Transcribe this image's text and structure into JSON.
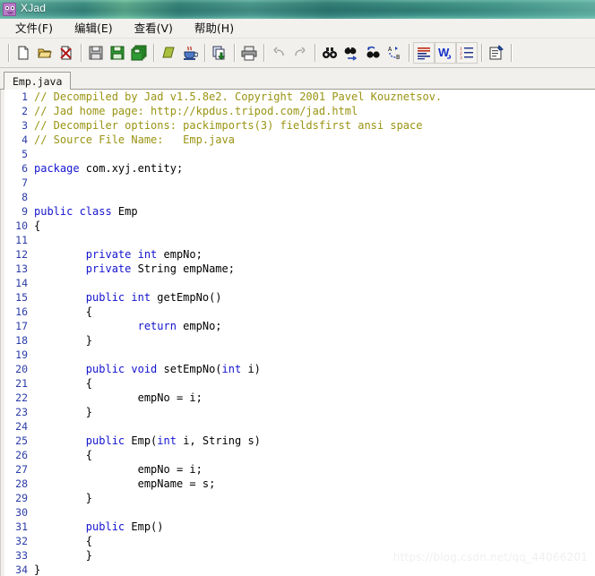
{
  "window": {
    "title": "XJad",
    "icon": "xjad-app-icon"
  },
  "menubar": {
    "items": [
      {
        "name": "file",
        "label": "文件(F)"
      },
      {
        "name": "edit",
        "label": "编辑(E)"
      },
      {
        "name": "view",
        "label": "查看(V)"
      },
      {
        "name": "help",
        "label": "帮助(H)"
      }
    ]
  },
  "toolbar": {
    "buttons": [
      {
        "name": "new-file-icon",
        "icon": "page",
        "state": "normal"
      },
      {
        "name": "open-folder-icon",
        "icon": "folder-open",
        "state": "normal"
      },
      {
        "name": "close-file-icon",
        "icon": "page-close-x",
        "state": "normal"
      },
      {
        "name": "save-icon",
        "icon": "floppy-gray",
        "state": "normal"
      },
      {
        "name": "save-as-icon",
        "icon": "floppy-green",
        "state": "normal"
      },
      {
        "name": "save-all-icon",
        "icon": "floppy-stack",
        "state": "normal"
      },
      {
        "name": "decompile-icon",
        "icon": "green-diamond",
        "state": "normal"
      },
      {
        "name": "java-coffee-icon",
        "icon": "coffee-cup",
        "state": "normal"
      },
      {
        "name": "export-file-icon",
        "icon": "page-arrow",
        "state": "normal"
      },
      {
        "name": "print-icon",
        "icon": "printer",
        "state": "normal"
      },
      {
        "name": "undo-icon",
        "icon": "arrow-undo",
        "state": "disabled"
      },
      {
        "name": "redo-icon",
        "icon": "arrow-redo",
        "state": "disabled"
      },
      {
        "name": "find-icon",
        "icon": "binoculars",
        "state": "normal"
      },
      {
        "name": "find-next-icon",
        "icon": "binoculars-next",
        "state": "normal"
      },
      {
        "name": "find-previous-icon",
        "icon": "binoculars-prev",
        "state": "normal"
      },
      {
        "name": "replace-icon",
        "icon": "replace-a-b",
        "state": "normal"
      },
      {
        "name": "format-align-icon",
        "icon": "align-lines",
        "state": "grouped"
      },
      {
        "name": "word-wrap-icon",
        "icon": "letter-w",
        "state": "grouped"
      },
      {
        "name": "line-numbers-icon",
        "icon": "numbered-list",
        "state": "grouped"
      },
      {
        "name": "properties-icon",
        "icon": "properties-pen",
        "state": "normal"
      }
    ]
  },
  "tabs": {
    "items": [
      {
        "name": "tab-emp-java",
        "label": "Emp.java",
        "active": true
      }
    ]
  },
  "editor": {
    "colors": {
      "keyword": "#1414cf",
      "comment": "#9a9412",
      "identifier": "#000000",
      "line_number": "#2b3ca8",
      "background": "#ffffff"
    },
    "lines": [
      {
        "n": 1,
        "tokens": [
          {
            "t": "// Decompiled by Jad v1.5.8e2. Copyright 2001 Pavel Kouznetsov.",
            "c": "cm"
          }
        ]
      },
      {
        "n": 2,
        "tokens": [
          {
            "t": "// Jad home page: http://kpdus.tripod.com/jad.html",
            "c": "cm"
          }
        ]
      },
      {
        "n": 3,
        "tokens": [
          {
            "t": "// Decompiler options: packimports(3) fieldsfirst ansi space",
            "c": "cm"
          }
        ]
      },
      {
        "n": 4,
        "tokens": [
          {
            "t": "// Source File Name:   Emp.java",
            "c": "cm"
          }
        ]
      },
      {
        "n": 5,
        "tokens": []
      },
      {
        "n": 6,
        "tokens": [
          {
            "t": "package",
            "c": "kw"
          },
          {
            "t": " com.xyj.entity;",
            "c": "id"
          }
        ]
      },
      {
        "n": 7,
        "tokens": []
      },
      {
        "n": 8,
        "tokens": []
      },
      {
        "n": 9,
        "tokens": [
          {
            "t": "public class",
            "c": "kw"
          },
          {
            "t": " Emp",
            "c": "id"
          }
        ]
      },
      {
        "n": 10,
        "tokens": [
          {
            "t": "{",
            "c": "id"
          }
        ]
      },
      {
        "n": 11,
        "tokens": []
      },
      {
        "n": 12,
        "tokens": [
          {
            "t": "        ",
            "c": "id"
          },
          {
            "t": "private int",
            "c": "kw"
          },
          {
            "t": " empNo;",
            "c": "id"
          }
        ]
      },
      {
        "n": 13,
        "tokens": [
          {
            "t": "        ",
            "c": "id"
          },
          {
            "t": "private",
            "c": "kw"
          },
          {
            "t": " String empName;",
            "c": "id"
          }
        ]
      },
      {
        "n": 14,
        "tokens": []
      },
      {
        "n": 15,
        "tokens": [
          {
            "t": "        ",
            "c": "id"
          },
          {
            "t": "public int",
            "c": "kw"
          },
          {
            "t": " getEmpNo()",
            "c": "id"
          }
        ]
      },
      {
        "n": 16,
        "tokens": [
          {
            "t": "        {",
            "c": "id"
          }
        ]
      },
      {
        "n": 17,
        "tokens": [
          {
            "t": "                ",
            "c": "id"
          },
          {
            "t": "return",
            "c": "kw"
          },
          {
            "t": " empNo;",
            "c": "id"
          }
        ]
      },
      {
        "n": 18,
        "tokens": [
          {
            "t": "        }",
            "c": "id"
          }
        ]
      },
      {
        "n": 19,
        "tokens": []
      },
      {
        "n": 20,
        "tokens": [
          {
            "t": "        ",
            "c": "id"
          },
          {
            "t": "public void",
            "c": "kw"
          },
          {
            "t": " setEmpNo(",
            "c": "id"
          },
          {
            "t": "int",
            "c": "kw"
          },
          {
            "t": " i)",
            "c": "id"
          }
        ]
      },
      {
        "n": 21,
        "tokens": [
          {
            "t": "        {",
            "c": "id"
          }
        ]
      },
      {
        "n": 22,
        "tokens": [
          {
            "t": "                empNo = i;",
            "c": "id"
          }
        ]
      },
      {
        "n": 23,
        "tokens": [
          {
            "t": "        }",
            "c": "id"
          }
        ]
      },
      {
        "n": 24,
        "tokens": []
      },
      {
        "n": 25,
        "tokens": [
          {
            "t": "        ",
            "c": "id"
          },
          {
            "t": "public",
            "c": "kw"
          },
          {
            "t": " Emp(",
            "c": "id"
          },
          {
            "t": "int",
            "c": "kw"
          },
          {
            "t": " i, String s)",
            "c": "id"
          }
        ]
      },
      {
        "n": 26,
        "tokens": [
          {
            "t": "        {",
            "c": "id"
          }
        ]
      },
      {
        "n": 27,
        "tokens": [
          {
            "t": "                empNo = i;",
            "c": "id"
          }
        ]
      },
      {
        "n": 28,
        "tokens": [
          {
            "t": "                empName = s;",
            "c": "id"
          }
        ]
      },
      {
        "n": 29,
        "tokens": [
          {
            "t": "        }",
            "c": "id"
          }
        ]
      },
      {
        "n": 30,
        "tokens": []
      },
      {
        "n": 31,
        "tokens": [
          {
            "t": "        ",
            "c": "id"
          },
          {
            "t": "public",
            "c": "kw"
          },
          {
            "t": " Emp()",
            "c": "id"
          }
        ]
      },
      {
        "n": 32,
        "tokens": [
          {
            "t": "        {",
            "c": "id"
          }
        ]
      },
      {
        "n": 33,
        "tokens": [
          {
            "t": "        }",
            "c": "id"
          }
        ]
      },
      {
        "n": 34,
        "tokens": [
          {
            "t": "}",
            "c": "id"
          }
        ]
      }
    ]
  },
  "watermark": {
    "text": "https://blog.csdn.net/qq_44066201"
  }
}
